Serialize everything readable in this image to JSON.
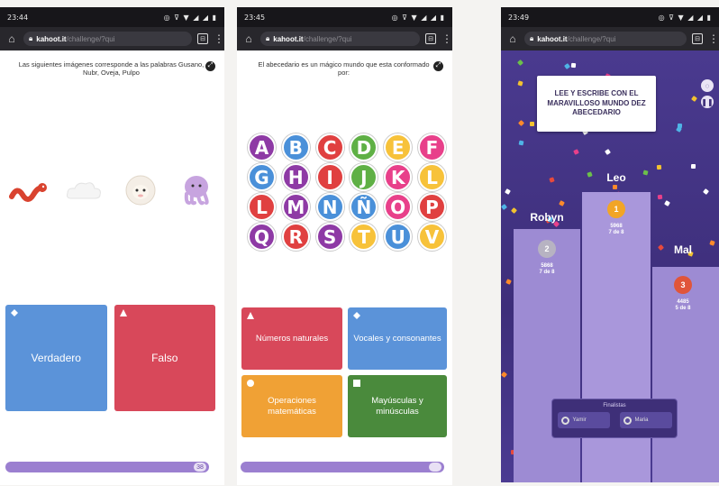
{
  "phone1": {
    "status": {
      "time": "23:44",
      "signal": "◎ ⊽ ▼ ◢ ◢ ▮"
    },
    "browser": {
      "domain": "kahoot.it",
      "path": "/challenge/?qui"
    },
    "question": "Las siguientes imágenes corresponde a las palabras Gusano, Nubr, Oveja, Pulpo",
    "images": [
      {
        "name": "worm",
        "color": "#d9432f"
      },
      {
        "name": "cloud",
        "color": "#f2f2f2"
      },
      {
        "name": "sheep",
        "color": "#f4eee6"
      },
      {
        "name": "octopus",
        "color": "#c7a4df"
      }
    ],
    "answers": [
      {
        "label": "Verdadero",
        "shape": "diamond",
        "color": "#5b93d9"
      },
      {
        "label": "Falso",
        "shape": "triangle",
        "color": "#d8485a"
      }
    ],
    "progress": "38"
  },
  "phone2": {
    "status": {
      "time": "23:45",
      "signal": "◎ ⊽ ▼ ◢ ◢ ▮"
    },
    "browser": {
      "domain": "kahoot.it",
      "path": "/challenge/?qui"
    },
    "question": "El abecedario es un mágico mundo que esta conformado por:",
    "letters": [
      [
        "A",
        "B",
        "C",
        "D",
        "E",
        "F"
      ],
      [
        "G",
        "H",
        "I",
        "J",
        "K",
        "L"
      ],
      [
        "L",
        "M",
        "N",
        "Ñ",
        "O",
        "P"
      ],
      [
        "Q",
        "R",
        "S",
        "T",
        "U",
        "V"
      ]
    ],
    "letter_colors": [
      [
        "#8e3aa5",
        "#4a90d9",
        "#e04040",
        "#5fb045",
        "#f7c23a",
        "#e8408a"
      ],
      [
        "#4a90d9",
        "#8e3aa5",
        "#e04040",
        "#5fb045",
        "#e8408a",
        "#f7c23a"
      ],
      [
        "#e04040",
        "#8e3aa5",
        "#4a90d9",
        "#4a90d9",
        "#e8408a",
        "#e04040"
      ],
      [
        "#8e3aa5",
        "#e04040",
        "#8e3aa5",
        "#f7c23a",
        "#4a90d9",
        "#f7c23a"
      ]
    ],
    "answers": [
      {
        "label": "Números naturales",
        "shape": "triangle",
        "color": "#d8485a"
      },
      {
        "label": "Vocales y consonantes",
        "shape": "diamond",
        "color": "#5b93d9"
      },
      {
        "label": "Operaciones matemáticas",
        "shape": "circle",
        "color": "#f0a135"
      },
      {
        "label": "Mayúsculas y minúsculas",
        "shape": "square",
        "color": "#4a8a3c"
      }
    ]
  },
  "phone3": {
    "status": {
      "time": "23:49",
      "signal": "◎ ⊽ ▼ ◢ ◢ ▮"
    },
    "browser": {
      "domain": "kahoot.it",
      "path": "/challenge/?qui"
    },
    "banner": "LEE Y ESCRIBE CON EL MARAVILLOSO MUNDO DEZ ABECEDARIO",
    "podium": [
      {
        "name": "Robyn",
        "place": "2",
        "score": "5868",
        "correct": "7 de 8",
        "medal_color": "#b7b3c2"
      },
      {
        "name": "Leo",
        "place": "1",
        "score": "5968",
        "correct": "7 de 8",
        "medal_color": "#f2a526"
      },
      {
        "name": "Mal",
        "place": "3",
        "score": "4485",
        "correct": "5 de 8",
        "medal_color": "#e0553a"
      }
    ],
    "final": {
      "title": "Finalistas",
      "btn1": "Yamir",
      "btn2": "Maria"
    }
  }
}
